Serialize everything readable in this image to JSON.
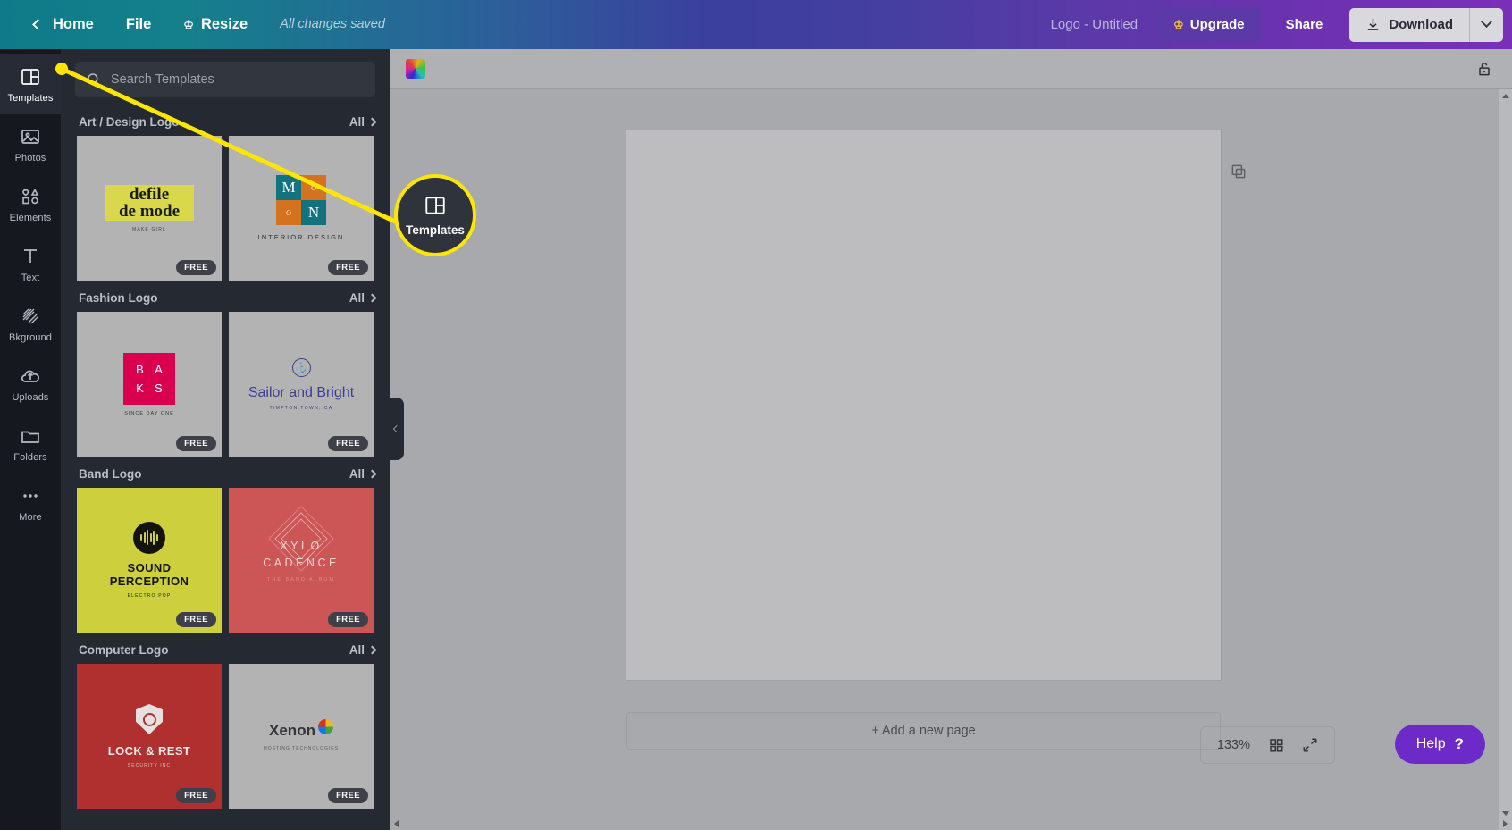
{
  "topbar": {
    "back_icon": "chevron-left-icon",
    "home": "Home",
    "file": "File",
    "resize": "Resize",
    "resize_icon": "crown-icon",
    "saved_status": "All changes saved",
    "doc_title": "Logo - Untitled",
    "upgrade": "Upgrade",
    "upgrade_icon": "crown-icon",
    "share": "Share",
    "download": "Download",
    "download_icon": "download-arrow-icon",
    "download_caret_icon": "chevron-down-icon"
  },
  "rail": {
    "items": [
      {
        "label": "Templates",
        "icon": "templates-grid-icon",
        "active": true
      },
      {
        "label": "Photos",
        "icon": "photo-image-icon",
        "active": false
      },
      {
        "label": "Elements",
        "icon": "shapes-icon",
        "active": false
      },
      {
        "label": "Text",
        "icon": "text-t-icon",
        "active": false
      },
      {
        "label": "Bkground",
        "icon": "hatch-pattern-icon",
        "active": false
      },
      {
        "label": "Uploads",
        "icon": "upload-cloud-icon",
        "active": false
      },
      {
        "label": "Folders",
        "icon": "folder-icon",
        "active": false
      },
      {
        "label": "More",
        "icon": "ellipsis-icon",
        "active": false
      }
    ]
  },
  "panel": {
    "search_placeholder": "Search Templates",
    "search_value": "",
    "search_icon": "search-icon",
    "all_label": "All",
    "free_badge": "FREE",
    "sections": [
      {
        "title": "Art / Design Logo",
        "cards": [
          {
            "name": "defile-de-mode",
            "line1": "defile",
            "line2": "de mode",
            "sub": "MAKE GIRL"
          },
          {
            "name": "moon-interior-design",
            "letters": [
              "M",
              "O",
              "O",
              "N"
            ],
            "sub": "INTERIOR DESIGN"
          }
        ]
      },
      {
        "title": "Fashion Logo",
        "cards": [
          {
            "name": "baks",
            "letters": [
              "B",
              "A",
              "K",
              "S"
            ],
            "sub": "SINCE DAY ONE"
          },
          {
            "name": "sailor-and-bright",
            "line1": "Sailor and Bright",
            "sub": "TIMPTON TOWN, CA"
          }
        ]
      },
      {
        "title": "Band Logo",
        "cards": [
          {
            "name": "sound-perception",
            "line1": "SOUND",
            "line2": "PERCEPTION",
            "sub": "ELECTRO POP"
          },
          {
            "name": "xylo-cadence",
            "line1": "XYLO",
            "line2": "CADENCE",
            "sub": "THE BAND ALBUM"
          }
        ]
      },
      {
        "title": "Computer Logo",
        "cards": [
          {
            "name": "lock-and-rest",
            "line1": "LOCK & REST",
            "sub": "SECURITY INC"
          },
          {
            "name": "xenon",
            "line1": "Xenon",
            "sub": "HOSTING TECHNOLOGIES"
          }
        ]
      }
    ],
    "collapse_icon": "chevron-left-icon"
  },
  "editor": {
    "color_swatch_icon": "color-gradient-swatch-icon",
    "lock_icon": "unlock-icon",
    "page_note_icon": "sticky-note-icon",
    "page_duplicate_icon": "duplicate-icon",
    "add_page_label": "+ Add a new page"
  },
  "footer": {
    "zoom_level": "133%",
    "grid_view_icon": "grid-view-icon",
    "fullscreen_icon": "expand-arrows-icon",
    "help_label": "Help",
    "help_mark": "?"
  },
  "callout": {
    "label": "Templates",
    "icon": "templates-grid-icon",
    "highlight_color": "#ffe600"
  }
}
